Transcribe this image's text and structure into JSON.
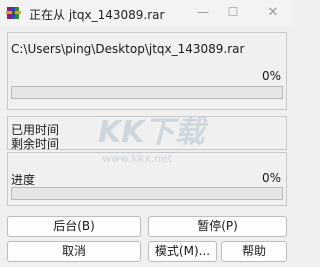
{
  "window": {
    "title": "正在从 jtqx_143089.rar",
    "min_glyph": "—",
    "max_glyph": "☐",
    "close_glyph": "✕"
  },
  "file_panel": {
    "path": "C:\\Users\\ping\\Desktop\\jtqx_143089.rar",
    "percent_text": "0%",
    "progress": 0
  },
  "time_panel": {
    "elapsed_label": "已用时间",
    "remaining_label": "剩余时间"
  },
  "total_panel": {
    "label": "进度",
    "percent_text": "0%",
    "progress": 0
  },
  "buttons": {
    "background": "后台(B)",
    "pause": "暂停(P)",
    "cancel": "取消",
    "mode": "模式(M)...",
    "help": "帮助"
  },
  "watermark": {
    "brand": "KK下载",
    "url": "www.kkx.net"
  },
  "colors": {
    "progress_fill": "#06b025",
    "watermark": "#c9d2dc"
  },
  "icons": {
    "app": "winrar-books-icon"
  }
}
